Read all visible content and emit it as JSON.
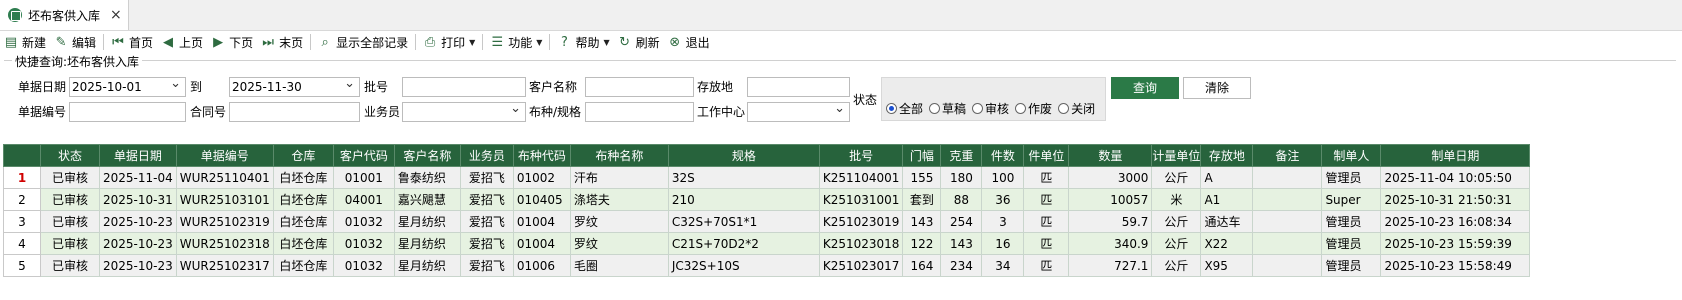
{
  "tab": {
    "title": "坯布客供入库",
    "close": "×"
  },
  "toolbar": [
    {
      "name": "new-button",
      "icon": "new-icon",
      "glyph": "▤",
      "label": "新建",
      "dropdown": false
    },
    {
      "name": "edit-button",
      "icon": "edit-icon",
      "glyph": "✎",
      "label": "编辑",
      "dropdown": false
    },
    {
      "name": "first-page-button",
      "icon": "first-page-icon",
      "glyph": "⏮",
      "label": "首页",
      "dropdown": false
    },
    {
      "name": "prev-page-button",
      "icon": "prev-page-icon",
      "glyph": "◀",
      "label": "上页",
      "dropdown": false
    },
    {
      "name": "next-page-button",
      "icon": "next-page-icon",
      "glyph": "▶",
      "label": "下页",
      "dropdown": false
    },
    {
      "name": "last-page-button",
      "icon": "last-page-icon",
      "glyph": "⏭",
      "label": "末页",
      "dropdown": false
    },
    {
      "name": "show-all-button",
      "icon": "search-doc-icon",
      "glyph": "⌕",
      "label": "显示全部记录",
      "dropdown": false
    },
    {
      "name": "print-button",
      "icon": "printer-icon",
      "glyph": "⎙",
      "label": "打印",
      "dropdown": true
    },
    {
      "name": "function-button",
      "icon": "function-icon",
      "glyph": "☰",
      "label": "功能",
      "dropdown": true
    },
    {
      "name": "help-button",
      "icon": "help-icon",
      "glyph": "?",
      "label": "帮助",
      "dropdown": true
    },
    {
      "name": "refresh-button",
      "icon": "refresh-icon",
      "glyph": "↻",
      "label": "刷新",
      "dropdown": false
    },
    {
      "name": "exit-button",
      "icon": "exit-icon",
      "glyph": "⊗",
      "label": "退出",
      "dropdown": false
    }
  ],
  "query": {
    "title": "快捷查询:坯布客供入库",
    "date_label": "单据日期",
    "date_from": "2025-10-01",
    "to_label": "到",
    "date_to": "2025-11-30",
    "batch_label": "批号",
    "batch_value": "",
    "customer_label": "客户名称",
    "customer_value": "",
    "location_label": "存放地",
    "location_value": "",
    "doc_no_label": "单据编号",
    "doc_no_value": "",
    "contract_label": "合同号",
    "contract_value": "",
    "salesman_label": "业务员",
    "salesman_value": "",
    "fabric_label": "布种/规格",
    "fabric_value": "",
    "workcenter_label": "工作中心",
    "workcenter_value": "",
    "status_label": "状态",
    "status_options": [
      "全部",
      "草稿",
      "审核",
      "作废",
      "关闭"
    ],
    "status_selected": "全部",
    "search_button": "查询",
    "clear_button": "清除"
  },
  "table": {
    "columns": [
      "",
      "状态",
      "单据日期",
      "单据编号",
      "仓库",
      "客户代码",
      "客户名称",
      "业务员",
      "布种代码",
      "布种名称",
      "规格",
      "批号",
      "门幅",
      "克重",
      "件数",
      "件单位",
      "数量",
      "计量单位",
      "存放地",
      "备注",
      "制单人",
      "制单日期"
    ],
    "rows": [
      [
        "1",
        "已审核",
        "2025-11-04",
        "WUR25110401",
        "白坯仓库",
        "01001",
        "鲁泰纺织",
        "爱招飞",
        "01002",
        "汗布",
        "32S",
        "K251104001",
        "155",
        "180",
        "100",
        "匹",
        "3000",
        "公斤",
        "A",
        "",
        "管理员",
        "2025-11-04 10:05:50"
      ],
      [
        "2",
        "已审核",
        "2025-10-31",
        "WUR25103101",
        "白坯仓库",
        "04001",
        "嘉兴飓慧",
        "爱招飞",
        "010405",
        "涤塔夫",
        "210",
        "K251031001",
        "套到",
        "88",
        "36",
        "匹",
        "10057",
        "米",
        "A1",
        "",
        "Super",
        "2025-10-31 21:50:31"
      ],
      [
        "3",
        "已审核",
        "2025-10-23",
        "WUR25102319",
        "白坯仓库",
        "01032",
        "星月纺织",
        "爱招飞",
        "01004",
        "罗纹",
        "C32S+70S1*1",
        "K251023019",
        "143",
        "254",
        "3",
        "匹",
        "59.7",
        "公斤",
        "通达车",
        "",
        "管理员",
        "2025-10-23 16:08:34"
      ],
      [
        "4",
        "已审核",
        "2025-10-23",
        "WUR25102318",
        "白坯仓库",
        "01032",
        "星月纺织",
        "爱招飞",
        "01004",
        "罗纹",
        "C21S+70D2*2",
        "K251023018",
        "122",
        "143",
        "16",
        "匹",
        "340.9",
        "公斤",
        "X22",
        "",
        "管理员",
        "2025-10-23 15:59:39"
      ],
      [
        "5",
        "已审核",
        "2025-10-23",
        "WUR25102317",
        "白坯仓库",
        "01032",
        "星月纺织",
        "爱招飞",
        "01006",
        "毛圈",
        "JC32S+10S",
        "K251023017",
        "164",
        "234",
        "34",
        "匹",
        "727.1",
        "公斤",
        "X95",
        "",
        "管理员",
        "2025-10-23 15:58:49"
      ]
    ]
  }
}
